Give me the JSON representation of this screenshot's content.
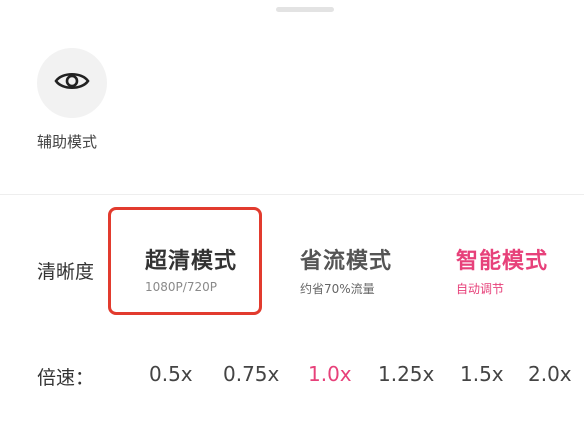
{
  "assist": {
    "icon": "eye-icon",
    "label": "辅助模式"
  },
  "quality": {
    "label": "清晰度",
    "options": [
      {
        "title": "超清模式",
        "subtitle": "1080P/720P"
      },
      {
        "title": "省流模式",
        "subtitle": "约省70%流量"
      },
      {
        "title": "智能模式",
        "subtitle": "自动调节"
      }
    ]
  },
  "speed": {
    "label": "倍速：",
    "options": [
      "0.5x",
      "0.75x",
      "1.0x",
      "1.25x",
      "1.5x",
      "2.0x"
    ],
    "selected": "1.0x"
  },
  "colors": {
    "accent": "#e7417a",
    "highlight_border": "#e23b2e"
  }
}
